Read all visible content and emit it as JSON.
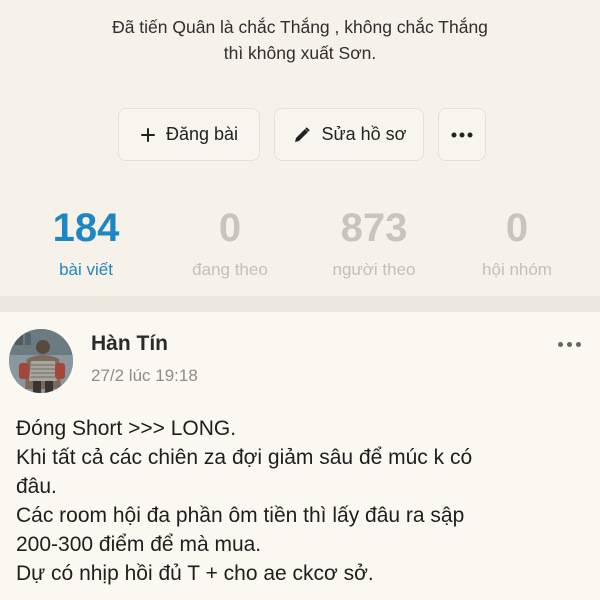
{
  "profile": {
    "bio_line1": "Đã tiến Quân là chắc Thắng , không chắc Thắng",
    "bio_line2": "thì không xuất Sơn."
  },
  "actions": {
    "post_label": "Đăng bài",
    "edit_label": "Sửa hồ sơ",
    "post_icon": "plus-icon",
    "edit_icon": "pencil-icon",
    "more_icon": "more-dots-icon"
  },
  "stats": [
    {
      "value": "184",
      "label": "bài viết",
      "active": true
    },
    {
      "value": "0",
      "label": "đang theo",
      "active": false
    },
    {
      "value": "873",
      "label": "người theo",
      "active": false
    },
    {
      "value": "0",
      "label": "hội nhóm",
      "active": false
    }
  ],
  "post": {
    "author": "Hàn Tín",
    "date": "27/2 lúc 19:18",
    "lines": [
      "Đóng Short >>> LONG.",
      "Khi tất cả các chiên za đợi giảm sâu để múc k có",
      "đâu.",
      "Các room hội đa phần ôm tiền thì lấy đâu ra sập",
      "200-300 điểm để mà mua.",
      "Dự có nhịp hồi đủ T + cho ae ckcơ sở."
    ]
  },
  "colors": {
    "accent": "#1f86c6",
    "muted": "#c9c4bd",
    "background": "#f6f2ea"
  }
}
